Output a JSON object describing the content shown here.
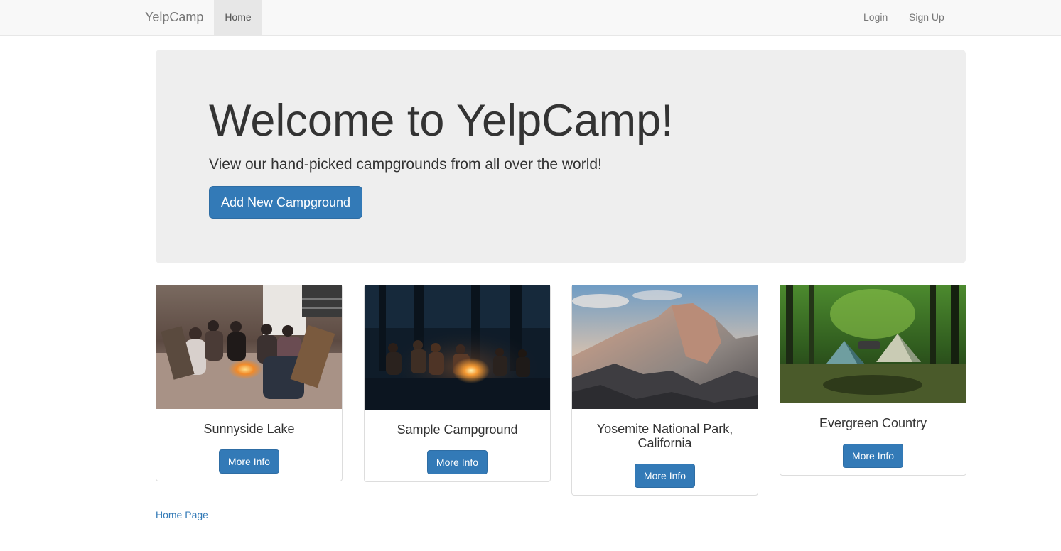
{
  "navbar": {
    "brand": "YelpCamp",
    "home": "Home",
    "login": "Login",
    "signup": "Sign Up"
  },
  "jumbotron": {
    "title": "Welcome to YelpCamp!",
    "subtitle": "View our hand-picked campgrounds from all over the world!",
    "button": "Add New Campground"
  },
  "campgrounds": [
    {
      "name": "Sunnyside Lake",
      "button": "More Info"
    },
    {
      "name": "Sample Campground",
      "button": "More Info"
    },
    {
      "name": "Yosemite National Park, California",
      "button": "More Info"
    },
    {
      "name": "Evergreen Country",
      "button": "More Info"
    }
  ],
  "footer": {
    "link": "Home Page"
  },
  "colors": {
    "primary": "#337ab7",
    "navbar_bg": "#f8f8f8",
    "jumbotron_bg": "#eeeeee"
  }
}
